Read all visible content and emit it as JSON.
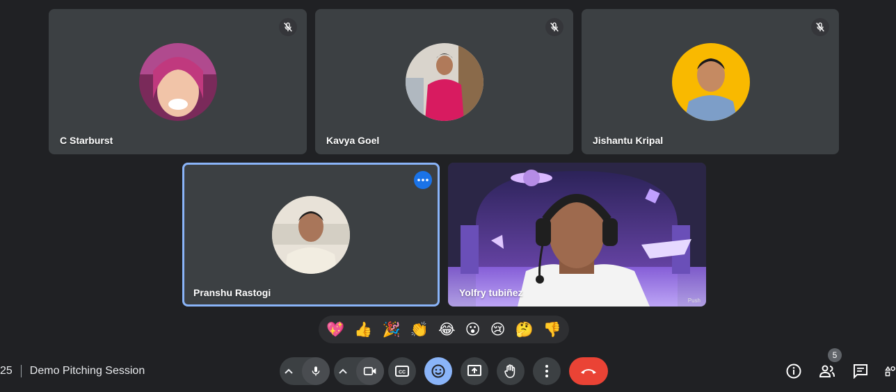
{
  "meeting": {
    "time_fragment": "25",
    "title": "Demo Pitching Session"
  },
  "participants": [
    {
      "name": "C Starburst",
      "muted": true
    },
    {
      "name": "Kavya Goel",
      "muted": true
    },
    {
      "name": "Jishantu Kripal",
      "muted": true
    },
    {
      "name": "Pranshu Rastogi",
      "active": true
    },
    {
      "name": "Yolfry tubiñez",
      "video_on": true
    }
  ],
  "video_watermark": "Push",
  "reactions": [
    "💖",
    "👍",
    "🎉",
    "👏",
    "😂",
    "😮",
    "😢",
    "🤔",
    "👎"
  ],
  "people_count": "5",
  "colors": {
    "background": "#202124",
    "tile": "#3c4043",
    "active_border": "#8ab4f8",
    "end_call": "#ea4335",
    "more_button": "#1a73e8"
  }
}
